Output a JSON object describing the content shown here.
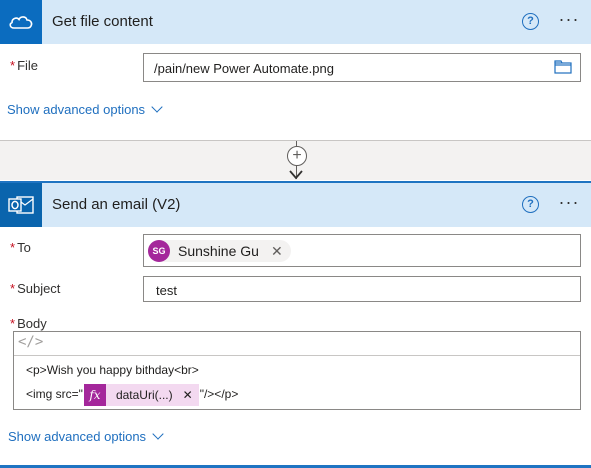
{
  "action1": {
    "title": "Get file content",
    "help_icon": "?",
    "more_icon": "···",
    "file_label": "File",
    "file_value": "/pain/new Power Automate.png",
    "advanced_label": "Show advanced options"
  },
  "connector": {
    "plus": "+"
  },
  "action2": {
    "title": "Send an email (V2)",
    "help_icon": "?",
    "more_icon": "···",
    "to_label": "To",
    "to_initials": "SG",
    "to_name": "Sunshine Gu",
    "remove_icon": "✕",
    "subject_label": "Subject",
    "subject_value": "test",
    "body_label": "Body",
    "code_icon": "</>",
    "body_line1": "<p>Wish you happy bithday<br>",
    "body_line2_prefix": "<img src=\"",
    "fx_label": "fx",
    "fx_name": "dataUri(...)",
    "body_line2_suffix": "\"/></p>",
    "advanced_label": "Show advanced options"
  },
  "colors": {
    "accent": "#1f6fbf",
    "header_bg": "#d5e8f8",
    "required": "#c50f1f",
    "fx": "#a4279b"
  }
}
